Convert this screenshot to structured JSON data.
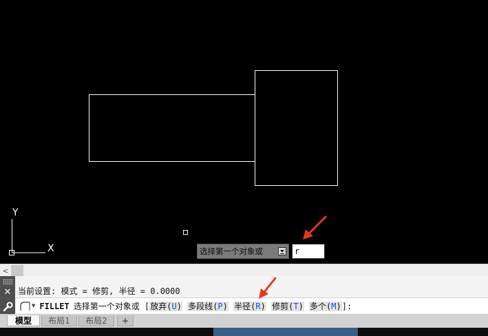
{
  "canvas": {
    "background": "#000000",
    "line_color": "#ffffff",
    "ucs_x_label": "X",
    "ucs_y_label": "Y",
    "annotation_color": "#e8371f"
  },
  "dynamic_input": {
    "prompt": "选择第一个对象或",
    "value": "r"
  },
  "command_line": {
    "history": "当前设置: 模式 = 修剪, 半径 = 0.0000",
    "command": "FILLET",
    "prompt": "选择第一个对象或",
    "options": [
      {
        "label": "放弃",
        "key": "U"
      },
      {
        "label": "多段线",
        "key": "P"
      },
      {
        "label": "半径",
        "key": "R"
      },
      {
        "label": "修剪",
        "key": "T"
      },
      {
        "label": "多个",
        "key": "M"
      }
    ]
  },
  "layout_tabs": [
    {
      "label": "模型",
      "active": true
    },
    {
      "label": "布局1",
      "active": false
    },
    {
      "label": "布局2",
      "active": false
    },
    {
      "label": "+",
      "active": false
    }
  ]
}
